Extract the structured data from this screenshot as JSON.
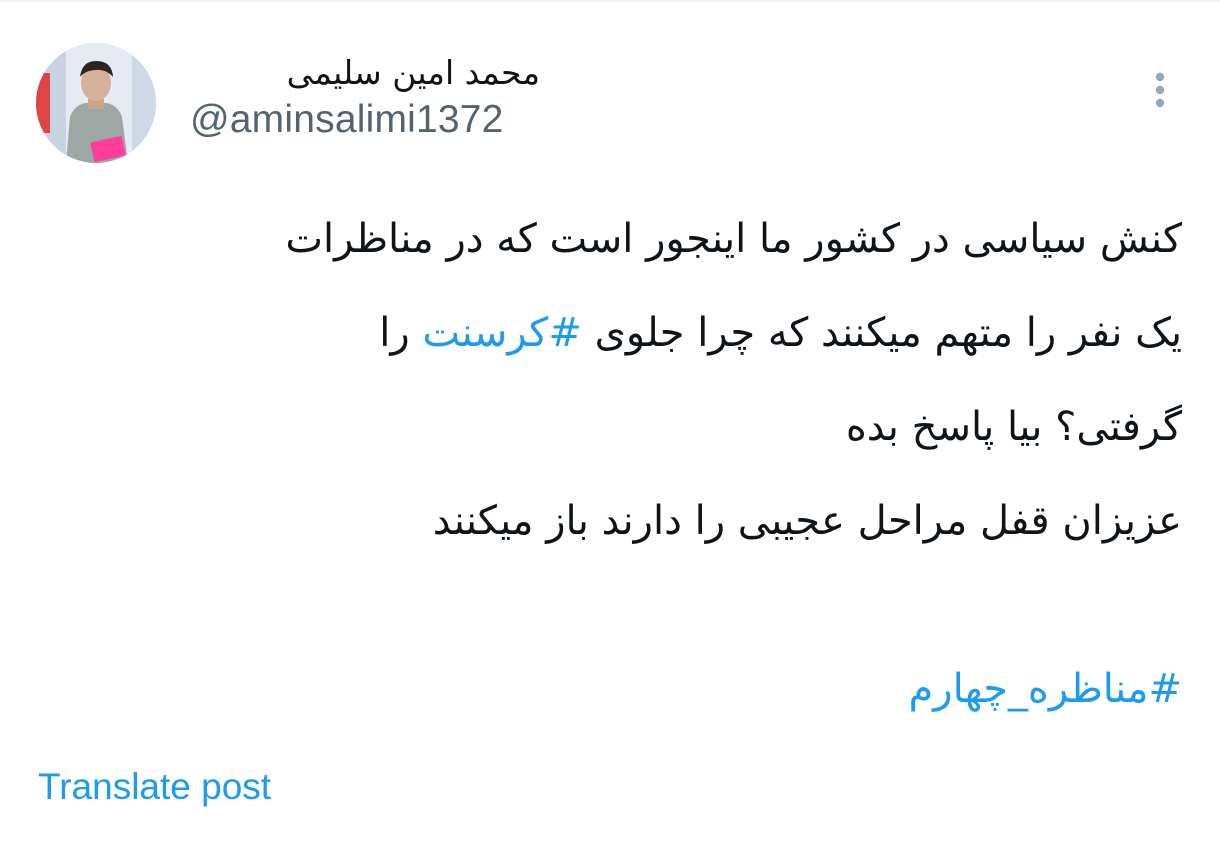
{
  "author": {
    "display_name": "محمد امین سلیمی",
    "handle": "@aminsalimi1372",
    "avatar_icon": "profile-photo"
  },
  "more_icon": "more-vertical-icon",
  "tweet": {
    "line1": "کنش سیاسی در کشور ما اینجور است که در مناظرات",
    "line2_before": "یک نفر را متهم میکنند که چرا جلوی ",
    "line2_hashtag": "#کرسنت",
    "line2_after": " را",
    "line3": "گرفتی؟ بیا پاسخ بده",
    "line4": "عزیزان قفل مراحل عجیبی را دارند باز میکنند",
    "hashtag2": "#مناظره_چهارم"
  },
  "translate_label": "Translate post",
  "colors": {
    "text": "#0f1419",
    "secondary": "#536471",
    "link": "#1d9bf0"
  }
}
